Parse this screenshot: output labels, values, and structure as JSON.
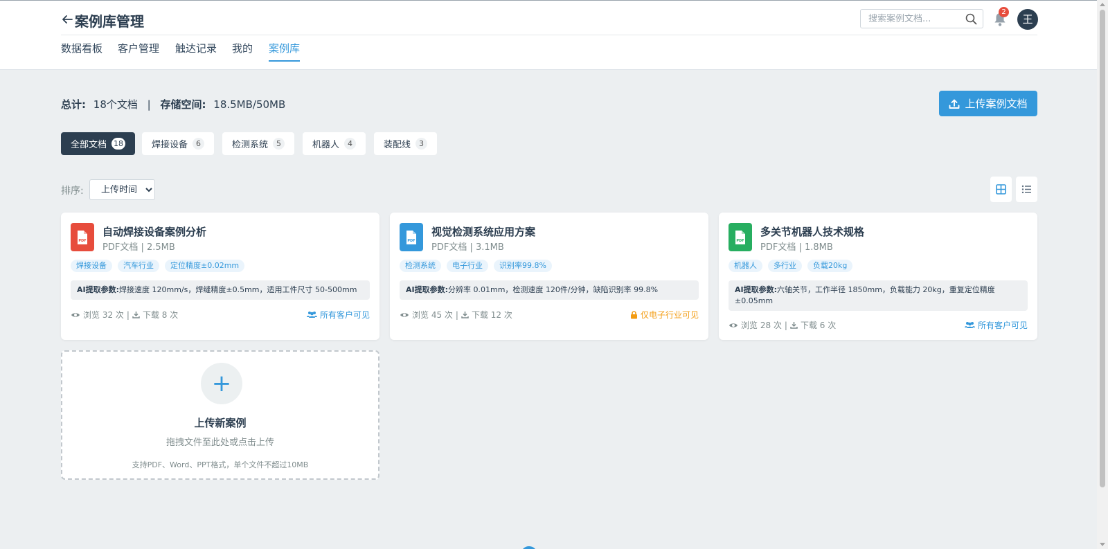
{
  "header": {
    "title": "案例库管理",
    "search_placeholder": "搜索案例文档...",
    "notification_count": "2",
    "avatar_text": "王"
  },
  "nav": {
    "items": [
      "数据看板",
      "客户管理",
      "触达记录",
      "我的",
      "案例库"
    ],
    "active": "案例库"
  },
  "stats": {
    "total_label": "总计:",
    "total_value": "18个文档",
    "separator": "|",
    "storage_label": "存储空间:",
    "storage_value": "18.5MB/50MB"
  },
  "upload_button": "上传案例文档",
  "filters": [
    {
      "label": "全部文档",
      "count": "18"
    },
    {
      "label": "焊接设备",
      "count": "6"
    },
    {
      "label": "检测系统",
      "count": "5"
    },
    {
      "label": "机器人",
      "count": "4"
    },
    {
      "label": "装配线",
      "count": "3"
    }
  ],
  "sort": {
    "label": "排序:",
    "selected": "上传时间"
  },
  "cards": [
    {
      "title": "自动焊接设备案例分析",
      "meta": "PDF文档 | 2.5MB",
      "tags": [
        "焊接设备",
        "汽车行业",
        "定位精度±0.02mm"
      ],
      "ai_label": "AI提取参数:",
      "ai_text": "焊接速度 120mm/s，焊缝精度±0.5mm，适用工件尺寸 50-500mm",
      "views": "浏览 32 次",
      "sep": "|",
      "downloads": "下载 8 次",
      "visibility": "所有客户可见",
      "icon_color": "#e74c3c"
    },
    {
      "title": "视觉检测系统应用方案",
      "meta": "PDF文档 | 3.1MB",
      "tags": [
        "检测系统",
        "电子行业",
        "识别率99.8%"
      ],
      "ai_label": "AI提取参数:",
      "ai_text": "分辨率 0.01mm，检测速度 120件/分钟，缺陷识别率 99.8%",
      "views": "浏览 45 次",
      "sep": "|",
      "downloads": "下载 12 次",
      "visibility": "仅电子行业可见",
      "icon_color": "#3498db"
    },
    {
      "title": "多关节机器人技术规格",
      "meta": "PDF文档 | 1.8MB",
      "tags": [
        "机器人",
        "多行业",
        "负载20kg"
      ],
      "ai_label": "AI提取参数:",
      "ai_text": "六轴关节，工作半径 1850mm，负载能力 20kg，重复定位精度 ±0.05mm",
      "views": "浏览 28 次",
      "sep": "|",
      "downloads": "下载 6 次",
      "visibility": "所有客户可见",
      "icon_color": "#27ae60"
    }
  ],
  "new_case": {
    "title": "上传新案例",
    "subtitle": "拖拽文件至此处或点击上传",
    "hint": "支持PDF、Word、PPT格式，单个文件不超过10MB"
  },
  "colors": {
    "accent": "#3498db",
    "dark": "#2c3e50",
    "warning": "#f39c12",
    "badge": "#e74c3c"
  }
}
